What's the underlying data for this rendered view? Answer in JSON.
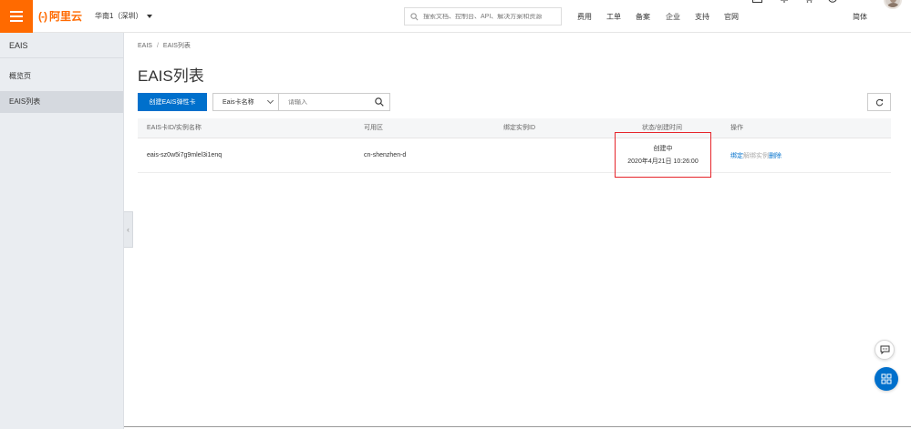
{
  "topbar": {
    "logo_mark": "(-)",
    "logo_text": "阿里云",
    "region": "华南1（深圳）",
    "search_placeholder": "搜索文档、控制台、API、解决方案和资源",
    "nav": [
      "费用",
      "工单",
      "备案",
      "企业",
      "支持",
      "官网"
    ],
    "language": "简体",
    "accent_color": "#ff6a00"
  },
  "sidebar": {
    "title": "EAIS",
    "items": [
      {
        "label": "概览页",
        "active": false
      },
      {
        "label": "EAIS列表",
        "active": true
      }
    ]
  },
  "main": {
    "breadcrumb": [
      "EAIS",
      "EAIS列表"
    ],
    "breadcrumb_sep": "/",
    "title": "EAIS列表",
    "toolbar": {
      "create_label": "创建EAIS弹性卡",
      "filter_select": "Eais卡名称",
      "search_placeholder": "请输入"
    },
    "table": {
      "columns": [
        "EAIS卡ID/实例名称",
        "可用区",
        "绑定实例ID",
        "状态/创建时间",
        "操作"
      ],
      "rows": [
        {
          "id": "eais-sz0w5i7g9mlel3i1enq",
          "zone": "cn-shenzhen-d",
          "bound_instance": "",
          "status": "创建中",
          "created": "2020年4月21日 10:26:00",
          "actions": {
            "bind": "绑定",
            "unbind": "解绑实例",
            "delete": "删除"
          }
        }
      ]
    }
  },
  "colors": {
    "primary": "#0070cc",
    "highlight_border": "#e6252b"
  }
}
